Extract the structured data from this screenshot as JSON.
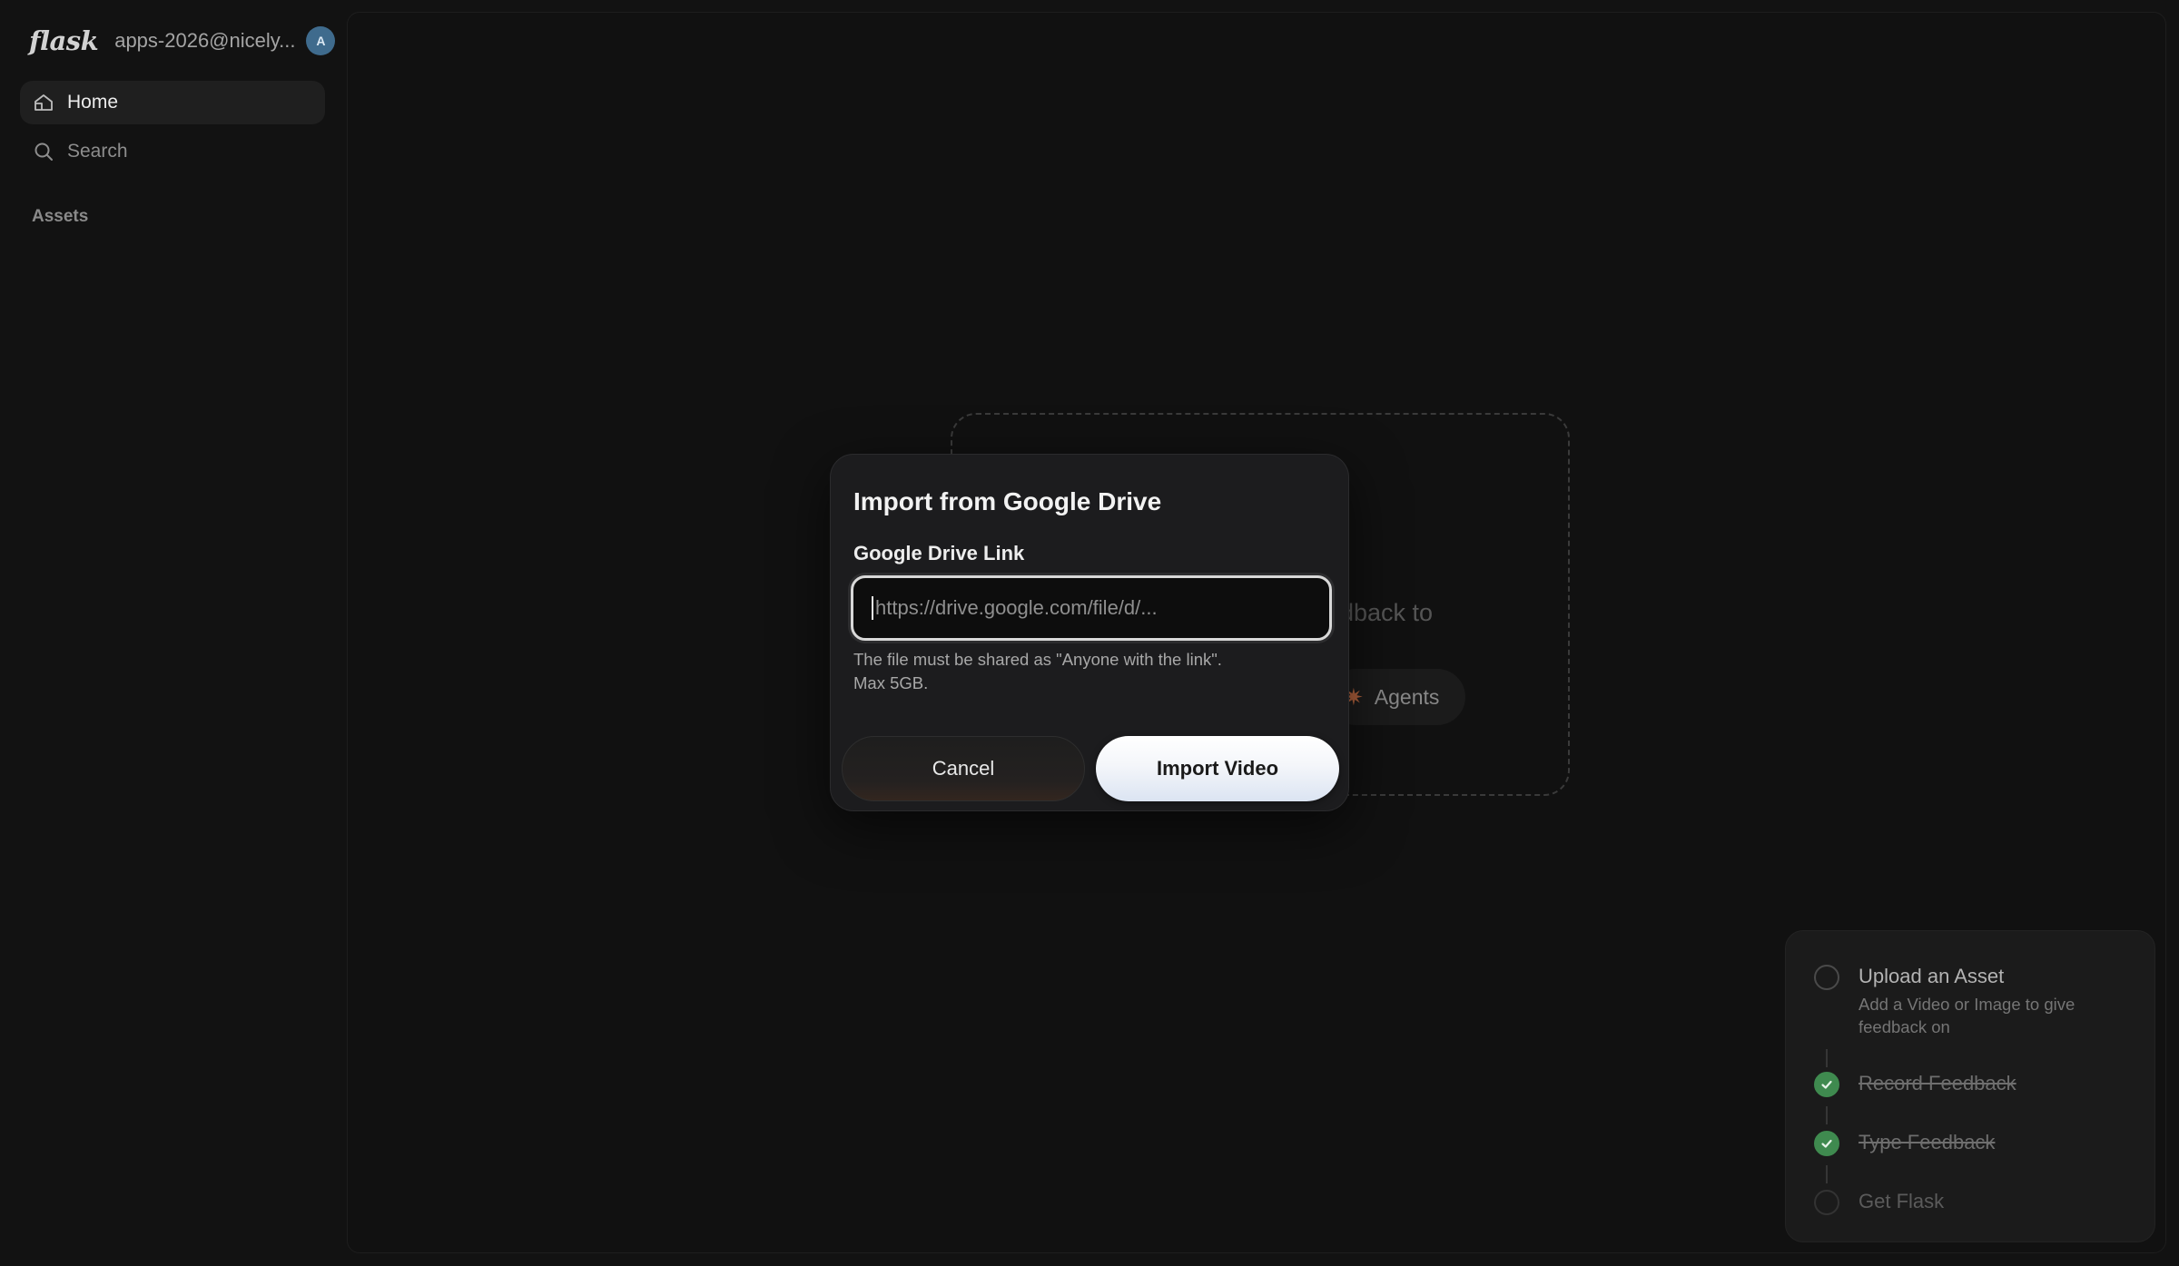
{
  "sidebar": {
    "logo": "flask",
    "account": "apps-2026@nicely...",
    "avatar_initial": "A",
    "nav": [
      {
        "label": "Home",
        "icon": "home-icon",
        "active": true
      },
      {
        "label": "Search",
        "icon": "search-icon",
        "active": false
      }
    ],
    "section_label": "Assets"
  },
  "background": {
    "dropzone_text": "dback to",
    "agents_label": "Agents"
  },
  "dialog": {
    "title": "Import from Google Drive",
    "field_label": "Google Drive Link",
    "input_value": "",
    "input_placeholder": "https://drive.google.com/file/d/...",
    "help_line1": "The file must be shared as \"Anyone with the link\".",
    "help_line2": "Max 5GB.",
    "cancel_label": "Cancel",
    "import_label": "Import Video"
  },
  "checklist": {
    "steps": [
      {
        "title": "Upload an Asset",
        "description": "Add a Video or Image to give feedback on",
        "status": "current"
      },
      {
        "title": "Record Feedback",
        "status": "done"
      },
      {
        "title": "Type Feedback",
        "status": "done"
      },
      {
        "title": "Get Flask",
        "status": "pending"
      }
    ]
  },
  "colors": {
    "background": "#121212",
    "dialog": "#1c1c1e",
    "success": "#3f8a4f",
    "avatar": "#3f6b8d",
    "agents_accent": "#b2623d"
  }
}
